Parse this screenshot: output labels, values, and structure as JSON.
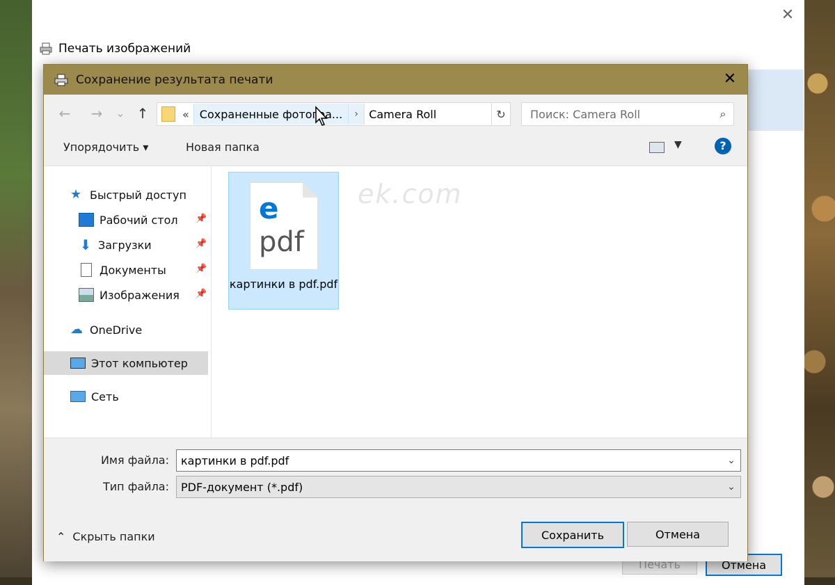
{
  "print_window": {
    "title": "Печать изображений",
    "close_glyph": "✕",
    "print_button": "Печать",
    "cancel_button": "Отмена"
  },
  "dialog": {
    "title": "Сохранение результата печати",
    "close_glyph": "✕",
    "nav": {
      "back": "←",
      "forward": "→",
      "recent": "⌄",
      "up": "↑",
      "address_prefix": "«",
      "breadcrumb_1": "Сохраненные фотогра...",
      "breadcrumb_sep": "›",
      "breadcrumb_2": "Camera Roll",
      "address_dropdown": "⌄",
      "refresh": "↻"
    },
    "search": {
      "placeholder": "Поиск: Camera Roll",
      "icon": "⌕"
    },
    "toolbar": {
      "organize": "Упорядочить ▾",
      "new_folder": "Новая папка",
      "view_dropdown": "▼",
      "help": "?"
    },
    "navpane": {
      "quick_access": "Быстрый доступ",
      "items": [
        {
          "label": "Рабочий стол",
          "icon": "desktop-icon"
        },
        {
          "label": "Загрузки",
          "icon": "download-icon"
        },
        {
          "label": "Документы",
          "icon": "documents-icon"
        },
        {
          "label": "Изображения",
          "icon": "pictures-icon"
        }
      ],
      "pin_glyph": "📌",
      "onedrive": "OneDrive",
      "this_pc": "Этот компьютер",
      "network": "Сеть"
    },
    "content": {
      "file_name": "картинки в pdf.pdf",
      "file_icon_letter": "e",
      "file_icon_ext": "pdf",
      "watermark": "ek.com"
    },
    "bottom": {
      "filename_label": "Имя файла:",
      "filename_value": "картинки в pdf.pdf",
      "type_label": "Тип файла:",
      "type_value": "PDF-документ (*.pdf)",
      "dropdown_glyph": "⌄",
      "hide_folders": "Скрыть папки",
      "hide_glyph": "⌃",
      "save": "Сохранить",
      "cancel": "Отмена"
    }
  }
}
